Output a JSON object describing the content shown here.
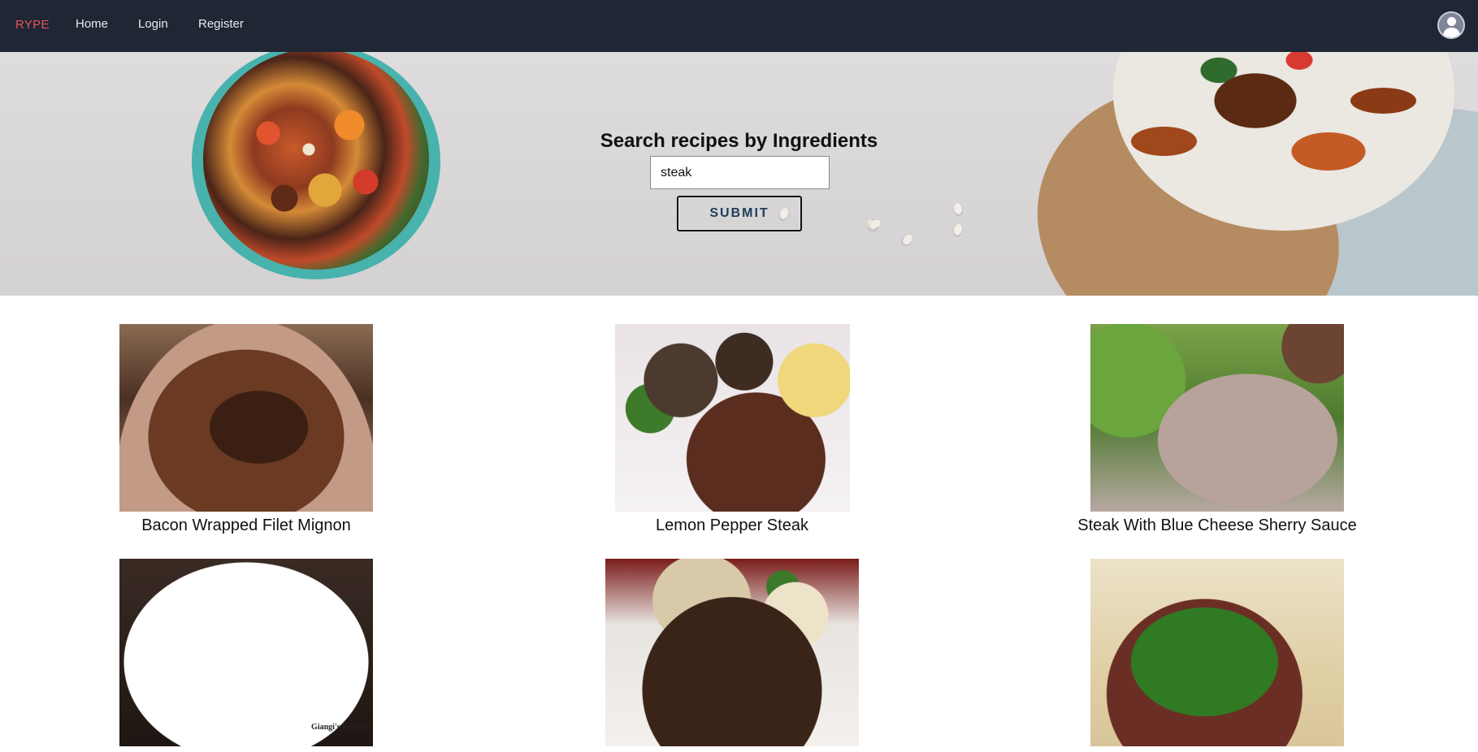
{
  "nav": {
    "brand": "RYPE",
    "home": "Home",
    "login": "Login",
    "register": "Register",
    "avatar_icon": "user-avatar-icon"
  },
  "hero": {
    "title": "Search recipes by Ingredients",
    "search_value": "steak",
    "submit_label": "SUBMIT"
  },
  "results": [
    {
      "title": "Bacon Wrapped Filet Mignon"
    },
    {
      "title": "Lemon Pepper Steak"
    },
    {
      "title": "Steak With Blue Cheese Sherry Sauce"
    },
    {
      "title": "",
      "watermark": "Giangi's Kitchen"
    },
    {
      "title": ""
    },
    {
      "title": ""
    }
  ],
  "colors": {
    "navbar": "#1f2634",
    "brand": "#e8555f",
    "submit_text": "#1d3d5a"
  }
}
